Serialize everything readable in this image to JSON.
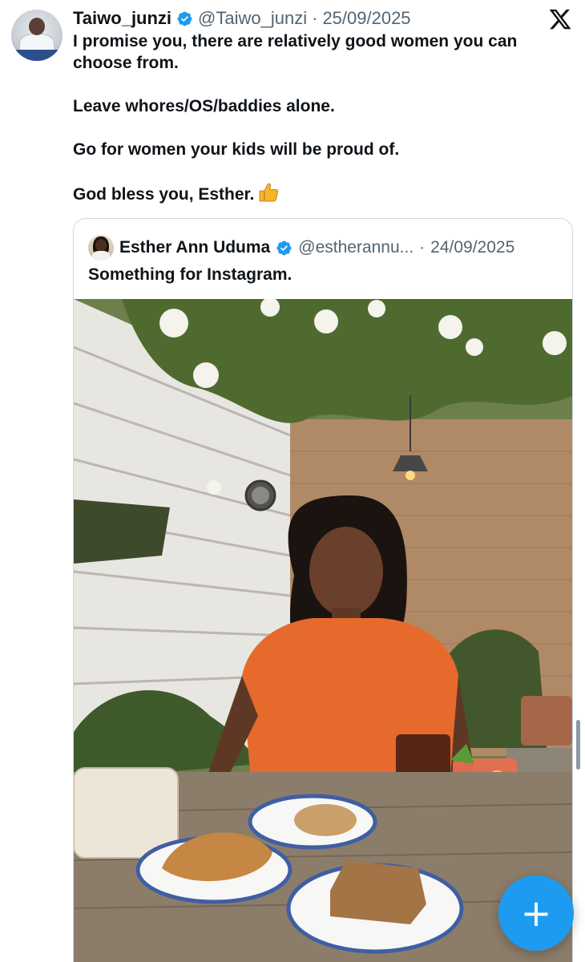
{
  "tweet": {
    "author_name": "Taiwo_junzi",
    "handle": "@Taiwo_junzi",
    "separator": "·",
    "date": "25/09/2025",
    "lines": [
      "I promise you, there are relatively good women you can choose from.",
      "Leave whores/OS/baddies alone.",
      "Go for women your kids will be proud of.",
      "God bless you, Esther."
    ],
    "emoji": "thumbs-up"
  },
  "quoted_tweet": {
    "author_name": "Esther Ann Uduma",
    "handle": "@estherannu...",
    "separator": "·",
    "date": "24/09/2025",
    "text": "Something for Instagram."
  },
  "fab": {
    "label": "+"
  },
  "icons": {
    "verified": "verified-badge-icon",
    "close": "x-logo-icon",
    "compose": "plus-icon"
  },
  "colors": {
    "accent": "#1d9bf0",
    "text": "#0f1419",
    "secondary": "#536471",
    "border": "#cfd9de"
  }
}
